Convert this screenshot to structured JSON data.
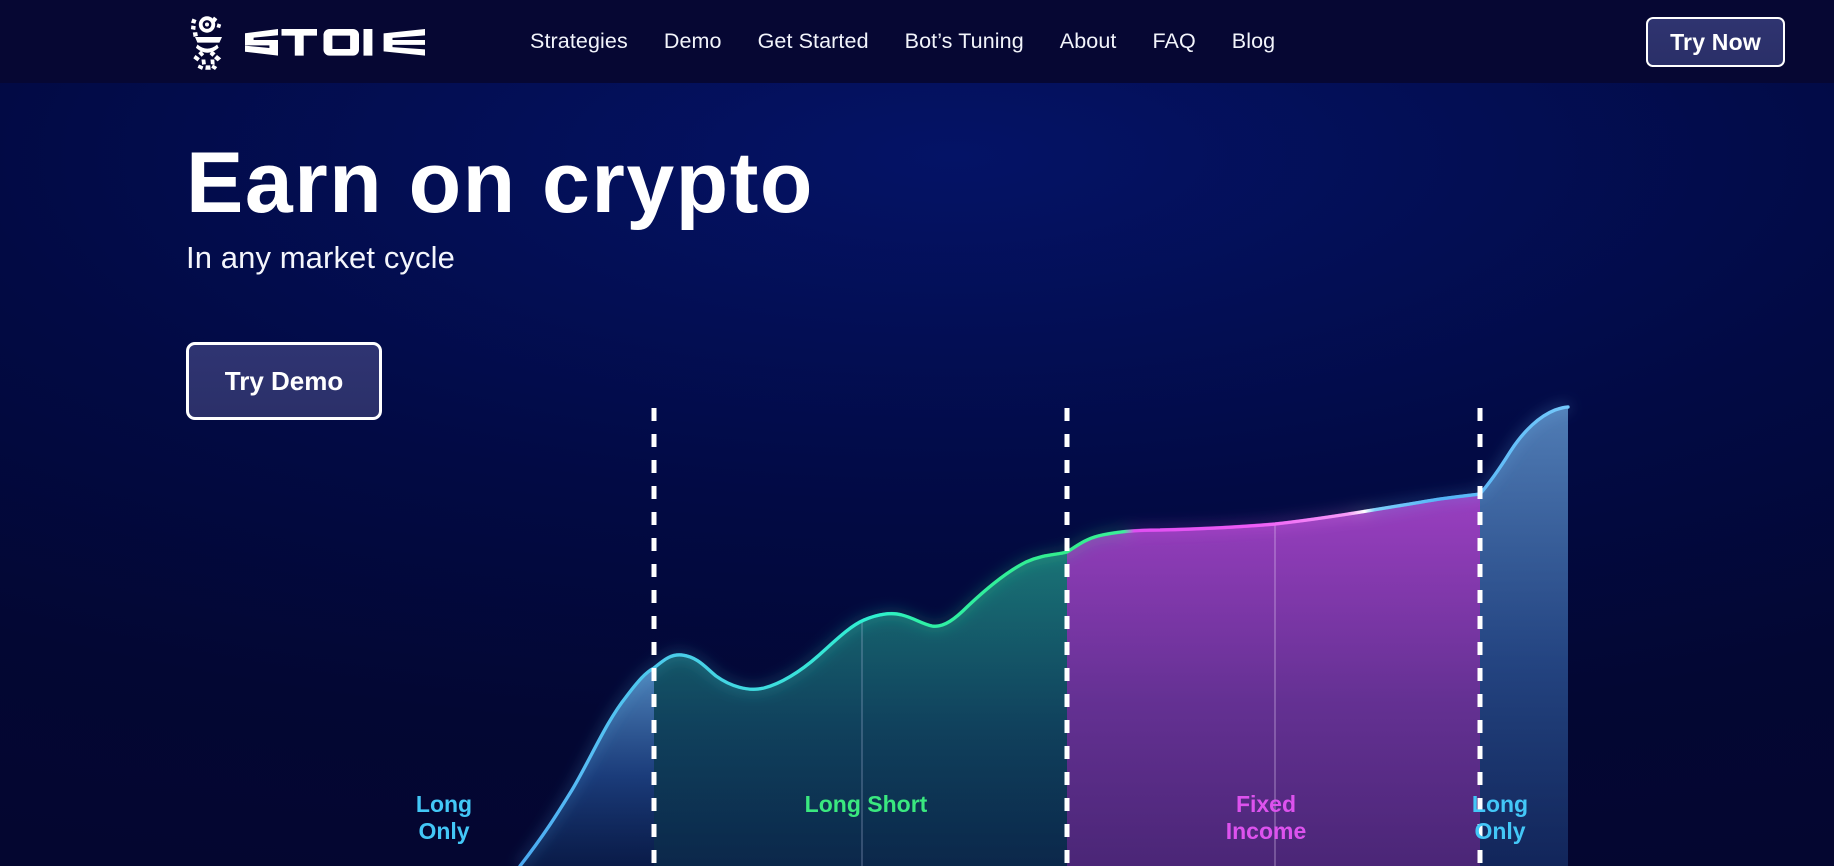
{
  "header": {
    "logo": {
      "icon": "stoic-statue-logo-icon",
      "wordmark": "STOIC"
    },
    "nav": [
      {
        "label": "Strategies"
      },
      {
        "label": "Demo"
      },
      {
        "label": "Get Started"
      },
      {
        "label": "Bot’s Tuning"
      },
      {
        "label": "About"
      },
      {
        "label": "FAQ"
      },
      {
        "label": "Blog"
      }
    ],
    "cta": {
      "label": "Try Now"
    }
  },
  "hero": {
    "title": "Earn on crypto",
    "subtitle": "In any market cycle",
    "cta": {
      "label": "Try Demo"
    }
  },
  "chart_data": {
    "type": "area",
    "title": "",
    "xlabel": "",
    "ylabel": "",
    "grid": false,
    "legend_position": "inline-bottom",
    "xlim": [
      0,
      1834
    ],
    "ylim": [
      866,
      408
    ],
    "description": "Equity-curve style area chart split into four market-cycle phases by white dashed vertical dividers.",
    "segments": [
      {
        "name": "Long Only",
        "label": "Long\nOnly",
        "color": "#43c7f7",
        "line_color": "#5ab6f2",
        "fill_from": "#2a68b8",
        "fill_to": "#123a7a",
        "x_start": 520,
        "x_end": 654,
        "label_x": 444,
        "label_y": 806
      },
      {
        "name": "Long Short",
        "label": "Long Short",
        "color": "#3ae87f",
        "line_color": "#2ff0b4",
        "fill_from": "#1e7e7e",
        "fill_to": "#14506a",
        "x_start": 654,
        "x_end": 1067,
        "label_x": 864,
        "label_y": 806
      },
      {
        "name": "Fixed Income",
        "label": "Fixed\nIncome",
        "color": "#dd52ee",
        "line_color": "#ee52f4",
        "fill_from": "#7b3aa8",
        "fill_to": "#5c2e86",
        "x_start": 1067,
        "x_end": 1480,
        "label_x": 1276,
        "label_y": 806
      },
      {
        "name": "Long Only",
        "label": "Long\nOnly",
        "color": "#43c7f7",
        "line_color": "#57b9f5",
        "fill_from": "#3c6fb6",
        "fill_to": "#1d3f7d",
        "x_start": 1480,
        "x_end": 1568,
        "label_x": 1500,
        "label_y": 806
      }
    ],
    "dividers_x": [
      654,
      1067,
      1480
    ],
    "gridlines_x": [
      862,
      1275
    ],
    "series": [
      {
        "name": "Equity curve",
        "points": [
          [
            520,
            866
          ],
          [
            548,
            830
          ],
          [
            572,
            790
          ],
          [
            596,
            745
          ],
          [
            620,
            705
          ],
          [
            654,
            668
          ],
          [
            680,
            655
          ],
          [
            710,
            664
          ],
          [
            740,
            680
          ],
          [
            762,
            688
          ],
          [
            790,
            680
          ],
          [
            815,
            660
          ],
          [
            840,
            634
          ],
          [
            862,
            620
          ],
          [
            890,
            613
          ],
          [
            912,
            616
          ],
          [
            930,
            626
          ],
          [
            952,
            620
          ],
          [
            980,
            600
          ],
          [
            1010,
            578
          ],
          [
            1040,
            562
          ],
          [
            1067,
            552
          ],
          [
            1090,
            540
          ],
          [
            1120,
            533
          ],
          [
            1160,
            530
          ],
          [
            1210,
            528
          ],
          [
            1275,
            524
          ],
          [
            1340,
            514
          ],
          [
            1400,
            504
          ],
          [
            1440,
            498
          ],
          [
            1480,
            494
          ],
          [
            1500,
            470
          ],
          [
            1520,
            438
          ],
          [
            1545,
            412
          ],
          [
            1568,
            408
          ]
        ]
      }
    ]
  }
}
